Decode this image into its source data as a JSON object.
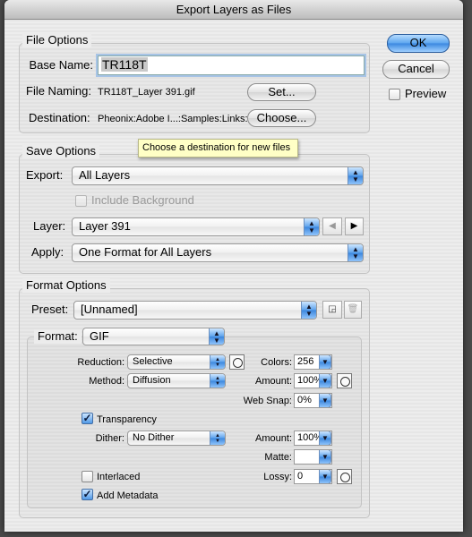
{
  "window": {
    "title": "Export Layers as Files"
  },
  "buttons": {
    "ok": "OK",
    "cancel": "Cancel",
    "preview": "Preview",
    "preview_checked": false
  },
  "file_options": {
    "title": "File Options",
    "base_name_label": "Base Name:",
    "base_name_value": "TR118T",
    "file_naming_label": "File Naming:",
    "file_naming_value": "TR118T_Layer 391.gif",
    "set_button": "Set...",
    "destination_label": "Destination:",
    "destination_value": "Pheonix:Adobe I...:Samples:Links:",
    "choose_button": "Choose..."
  },
  "tooltip": "Choose a destination for new files",
  "save_options": {
    "title": "Save Options",
    "export_label": "Export:",
    "export_value": "All Layers",
    "include_background": "Include Background",
    "include_background_checked": false,
    "layer_label": "Layer:",
    "layer_value": "Layer 391",
    "apply_label": "Apply:",
    "apply_value": "One Format for All Layers"
  },
  "format_options": {
    "title": "Format Options",
    "preset_label": "Preset:",
    "preset_value": "[Unnamed]",
    "format_label": "Format:",
    "format_value": "GIF",
    "reduction_label": "Reduction:",
    "reduction_value": "Selective",
    "method_label": "Method:",
    "method_value": "Diffusion",
    "colors_label": "Colors:",
    "colors_value": "256",
    "amount_label": "Amount:",
    "amount_value": "100%",
    "websnap_label": "Web Snap:",
    "websnap_value": "0%",
    "transparency": "Transparency",
    "transparency_checked": true,
    "dither_label": "Dither:",
    "dither_value": "No Dither",
    "dither_amount_label": "Amount:",
    "dither_amount_value": "100%",
    "matte_label": "Matte:",
    "matte_value": "",
    "interlaced": "Interlaced",
    "interlaced_checked": false,
    "lossy_label": "Lossy:",
    "lossy_value": "0",
    "add_metadata": "Add Metadata",
    "add_metadata_checked": true
  }
}
